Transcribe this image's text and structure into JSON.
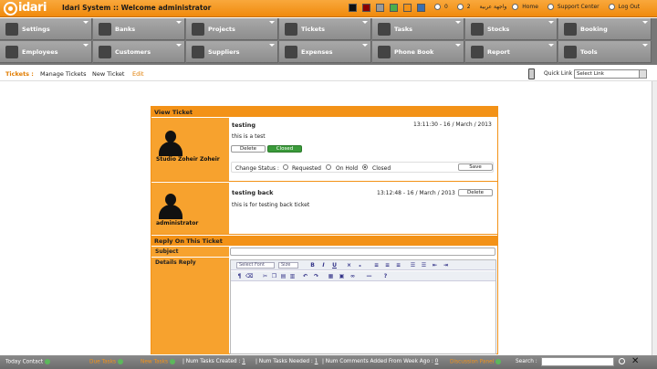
{
  "header": {
    "logo_text": "idari",
    "title": "Idari System :: Welcome administrator",
    "swatches": [
      "#111111",
      "#8b0000",
      "#9a9a9a",
      "#4cae4c",
      "#f39217",
      "#3a6fb0"
    ],
    "mail_count": "0",
    "tasks_count": "2",
    "arabic": "واجهة عربية",
    "home": "Home",
    "support": "Support Center",
    "logout": "Log Out"
  },
  "nav": {
    "row1": [
      {
        "label": "Settings",
        "icon": "wrench-icon"
      },
      {
        "label": "Banks",
        "icon": "bank-icon"
      },
      {
        "label": "Projects",
        "icon": "star-icon"
      },
      {
        "label": "Tickets",
        "icon": "ticket-icon"
      },
      {
        "label": "Tasks",
        "icon": "tasks-icon"
      },
      {
        "label": "Stocks",
        "icon": "truck-icon"
      },
      {
        "label": "Booking",
        "icon": "book-icon"
      }
    ],
    "row2": [
      {
        "label": "Employees",
        "icon": "employees-icon"
      },
      {
        "label": "Customers",
        "icon": "customers-icon"
      },
      {
        "label": "Suppliers",
        "icon": "suppliers-icon"
      },
      {
        "label": "Expenses",
        "icon": "briefcase-icon"
      },
      {
        "label": "Phone Book",
        "icon": "phone-icon"
      },
      {
        "label": "Report",
        "icon": "report-icon"
      },
      {
        "label": "Tools",
        "icon": "gear-icon"
      }
    ]
  },
  "subnav": {
    "section": "Tickets :",
    "manage": "Manage Tickets",
    "new": "New Ticket",
    "edit": "Edit",
    "quick_link_label": "Quick Link",
    "quick_link_value": "Select Link"
  },
  "view": {
    "heading": "View Ticket",
    "ticket1": {
      "author": "Studio Zoheir Zoheir",
      "title": "testing",
      "date": "13:11:30 - 16 / March / 2013",
      "body": "this is a test",
      "delete": "Delete",
      "status_badge": "Closed",
      "change_status": "Change Status :",
      "opt_requested": "Requested",
      "opt_on_hold": "On Hold",
      "opt_closed": "Closed",
      "save": "Save"
    },
    "ticket2": {
      "author": "administrator",
      "title": "testing back",
      "date": "13:12:48 - 16 / March / 2013",
      "delete": "Delete",
      "body": "this is for testing back ticket"
    }
  },
  "reply": {
    "heading": "Reply On This Ticket",
    "subject_label": "Subject",
    "details_label": "Details Reply",
    "font_select": "Select Font",
    "size_select": "Size"
  },
  "footer": {
    "item1": "Today Contact",
    "item2": "Due Tasks",
    "item3": "New Tasks",
    "created_label": "| Num Tasks Created :",
    "created_val": "1",
    "needed_label": "| Num Tasks Needed :",
    "needed_val": "1",
    "comments_label": "| Num Comments Added From Week Ago :",
    "comments_val": "0",
    "item4": "Discussion Panel",
    "search_label": "Search :"
  }
}
